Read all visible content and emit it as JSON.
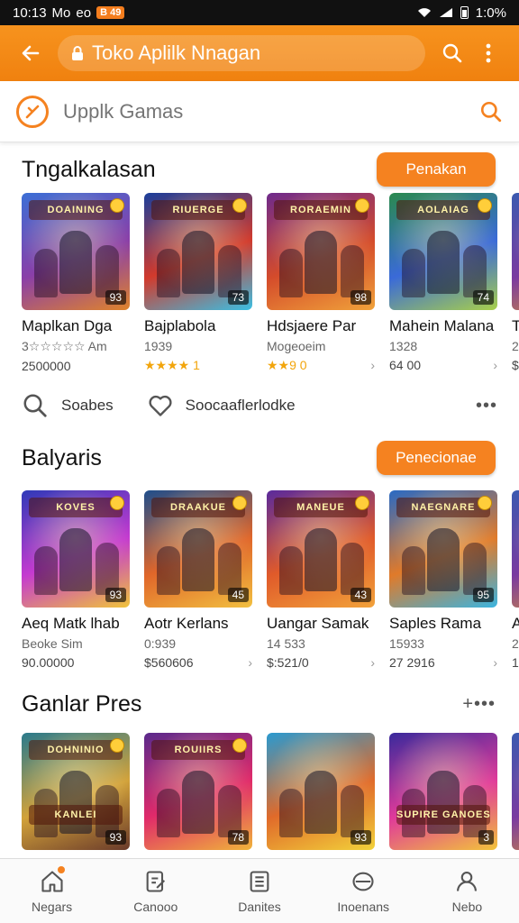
{
  "status_bar": {
    "time": "10:13",
    "carrier": "Mo",
    "carrier_suffix": "eo",
    "notif_label": "B 49",
    "battery": "1:0%"
  },
  "app_bar": {
    "title": "Toko Aplilk  Nnagan"
  },
  "search": {
    "placeholder": "Upplk Gamas"
  },
  "sections": [
    {
      "title": "Tngalkalasan",
      "button": "Penakan",
      "cards": [
        {
          "banner": "DOAINING",
          "name": "Maplkan Dga",
          "sub": "3☆☆☆☆☆ Am",
          "meta": "2500000",
          "meta_right": "",
          "badge": "93",
          "colors": [
            "#3b6fd6",
            "#8a3fa8",
            "#e0842a"
          ]
        },
        {
          "banner": "RIUERGE",
          "name": "Bajplabola",
          "sub": "1939",
          "meta": "★★★★ 1",
          "meta_right": "",
          "badge": "73",
          "colors": [
            "#1a3f9c",
            "#d23a2c",
            "#3ac0e4"
          ]
        },
        {
          "banner": "RORAEMIN",
          "name": "Hdsjaere Par",
          "sub": "Mogeoeim",
          "meta": "★★9 0",
          "meta_right": "›",
          "badge": "98",
          "colors": [
            "#6e2a8c",
            "#d44b2b",
            "#f0a23a"
          ]
        },
        {
          "banner": "AOLAIAG",
          "name": "Mahein Malana",
          "sub": "1328",
          "meta": "64 00",
          "meta_right": "›",
          "badge": "74",
          "colors": [
            "#2a8a4e",
            "#3a6ad8",
            "#a8d04a"
          ]
        },
        {
          "banner": "",
          "name": "Tu",
          "sub": "2",
          "meta": "$",
          "meta_right": "",
          "badge": "",
          "colors": [
            "#3a5ab0",
            "#7a3aa0",
            "#e09a2a"
          ]
        }
      ]
    },
    {
      "title": "Balyaris",
      "button": "Penecionae",
      "cards": [
        {
          "banner": "KOVES",
          "name": "Aeq Matk lhab",
          "sub": "Beoke Sim",
          "meta": "90.00000",
          "meta_right": "",
          "badge": "93",
          "colors": [
            "#2f3ab8",
            "#c43ad0",
            "#f0c43a"
          ]
        },
        {
          "banner": "DRAAKUE",
          "name": "Aotr Kerlans",
          "sub": "0:939",
          "meta": "$560606",
          "meta_right": "›",
          "badge": "45",
          "colors": [
            "#1f4e8c",
            "#e0662a",
            "#f2c040"
          ]
        },
        {
          "banner": "MANEUE",
          "name": "Uangar Samak",
          "sub": "14 533",
          "meta": "$:521/0",
          "meta_right": "›",
          "badge": "43",
          "colors": [
            "#5a2a9c",
            "#e05a2a",
            "#f2a23a"
          ]
        },
        {
          "banner": "NAEGNARE",
          "name": "Saples Rama",
          "sub": "15933",
          "meta": "27 2916",
          "meta_right": "›",
          "badge": "95",
          "colors": [
            "#2a6ac4",
            "#e07a2a",
            "#3ab4e0"
          ]
        },
        {
          "banner": "",
          "name": "A",
          "sub": "2",
          "meta": "1",
          "meta_right": "",
          "badge": "",
          "colors": [
            "#3a5ab0",
            "#7a3aa0",
            "#e09a2a"
          ]
        }
      ]
    },
    {
      "title": "Ganlar Pres",
      "button": "",
      "more": "+•••",
      "cards": [
        {
          "banner": "DOHNINIO",
          "name": "",
          "sub": "",
          "meta": "",
          "meta_right": "",
          "badge": "93",
          "caption": "KANLEI",
          "colors": [
            "#2a7a8c",
            "#d2a23a",
            "#6a3a2a"
          ]
        },
        {
          "banner": "ROUIIRS",
          "name": "",
          "sub": "",
          "meta": "",
          "meta_right": "",
          "badge": "78",
          "caption": "",
          "colors": [
            "#5a2a8c",
            "#e02a6a",
            "#f0b43a"
          ]
        },
        {
          "banner": "",
          "name": "",
          "sub": "",
          "meta": "",
          "meta_right": "",
          "badge": "93",
          "caption": "",
          "colors": [
            "#2a9ad0",
            "#e06a2a",
            "#f2d23a"
          ]
        },
        {
          "banner": "",
          "name": "",
          "sub": "",
          "meta": "",
          "meta_right": "",
          "badge": "3",
          "caption": "SUPIRE GANOES",
          "colors": [
            "#3a2a9c",
            "#e03a9a",
            "#f2c43a"
          ]
        },
        {
          "banner": "",
          "name": "",
          "sub": "",
          "meta": "",
          "meta_right": "",
          "badge": "",
          "caption": "",
          "colors": [
            "#3a5ab0",
            "#7a3aa0",
            "#e09a2a"
          ]
        }
      ]
    }
  ],
  "actions": [
    {
      "label": "Soabes",
      "icon": "search-icon"
    },
    {
      "label": "Soocaaflerlodke",
      "icon": "heart-icon"
    }
  ],
  "bottom_nav": [
    {
      "label": "Negars",
      "icon": "home-icon"
    },
    {
      "label": "Canooo",
      "icon": "edit-icon"
    },
    {
      "label": "Danites",
      "icon": "list-icon"
    },
    {
      "label": "Inoenans",
      "icon": "tag-icon"
    },
    {
      "label": "Nebo",
      "icon": "user-icon"
    }
  ],
  "colors": {
    "accent": "#f58220",
    "text": "#111111",
    "star": "#f2a50c"
  }
}
